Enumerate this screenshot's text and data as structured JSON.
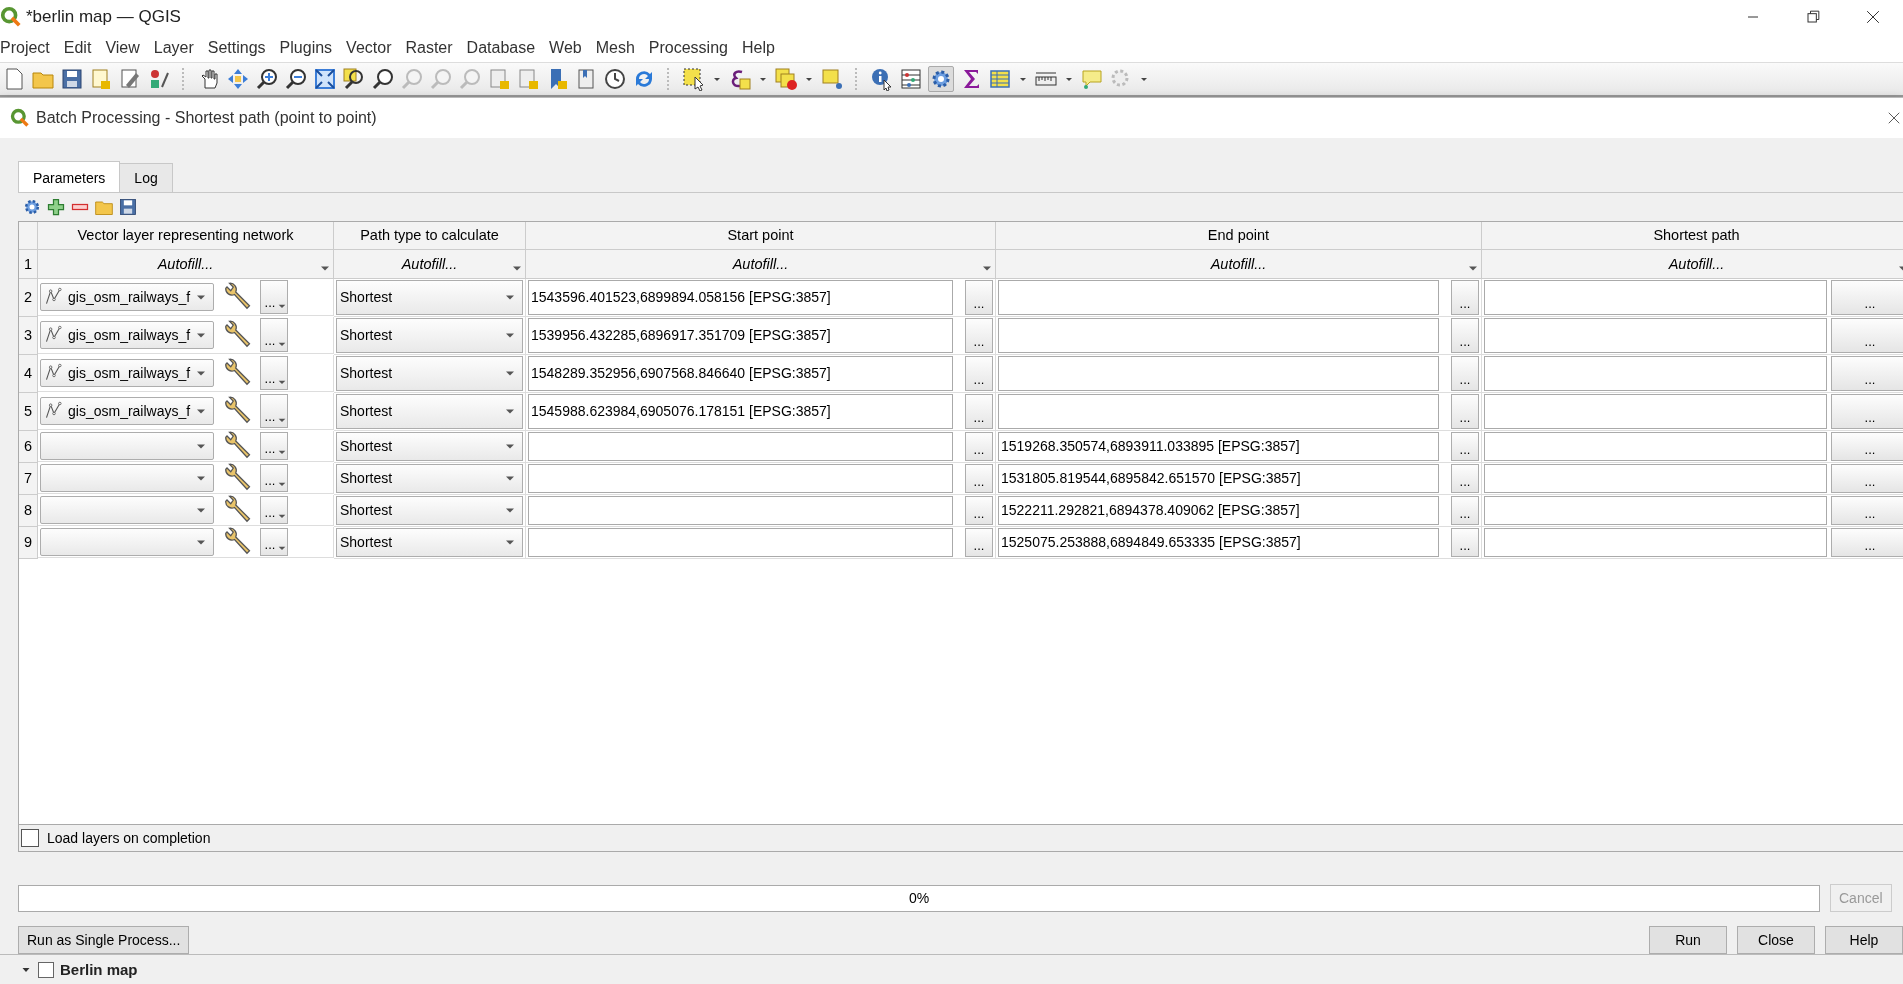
{
  "window": {
    "title": "*berlin map — QGIS"
  },
  "menu": [
    "Project",
    "Edit",
    "View",
    "Layer",
    "Settings",
    "Plugins",
    "Vector",
    "Raster",
    "Database",
    "Web",
    "Mesh",
    "Processing",
    "Help"
  ],
  "dialog": {
    "title": "Batch Processing - Shortest path (point to point)",
    "tabs": [
      {
        "label": "Parameters",
        "selected": true
      },
      {
        "label": "Log",
        "selected": false
      }
    ],
    "table": {
      "columns": [
        "Vector layer representing network",
        "Path type to calculate",
        "Start point",
        "End point",
        "Shortest path"
      ],
      "autofill_row": {
        "number": "1",
        "labels": [
          "Autofill...",
          "Autofill...",
          "Autofill...",
          "Autofill...",
          "Autofill..."
        ]
      },
      "rows": [
        {
          "number": "2",
          "layer": "gis_osm_railways_f",
          "layer_button": "...",
          "path_type": "Shortest",
          "start_point": "1543596.401523,6899894.058156 [EPSG:3857]",
          "start_button": "...",
          "end_button": "...",
          "output_button": "..."
        },
        {
          "number": "3",
          "layer": "gis_osm_railways_f",
          "layer_button": "...",
          "path_type": "Shortest",
          "start_point": "1539956.432285,6896917.351709 [EPSG:3857]",
          "start_button": "...",
          "end_button": "...",
          "output_button": "..."
        },
        {
          "number": "4",
          "layer": "gis_osm_railways_f",
          "layer_button": "...",
          "path_type": "Shortest",
          "start_point": "1548289.352956,6907568.846640 [EPSG:3857]",
          "start_button": "...",
          "end_button": "...",
          "output_button": "..."
        },
        {
          "number": "5",
          "layer": "gis_osm_railways_f",
          "layer_button": "...",
          "path_type": "Shortest",
          "start_point": "1545988.623984,6905076.178151 [EPSG:3857]",
          "start_button": "...",
          "end_button": "...",
          "output_button": "..."
        },
        {
          "number": "6",
          "layer_button": "...",
          "path_type": "Shortest",
          "start_button": "...",
          "end_point": "1519268.350574,6893911.033895 [EPSG:3857]",
          "end_button": "...",
          "output_button": "..."
        },
        {
          "number": "7",
          "layer_button": "...",
          "path_type": "Shortest",
          "start_button": "...",
          "end_point": "1531805.819544,6895842.651570 [EPSG:3857]",
          "end_button": "...",
          "output_button": "..."
        },
        {
          "number": "8",
          "layer_button": "...",
          "path_type": "Shortest",
          "start_button": "...",
          "end_point": "1522211.292821,6894378.409062 [EPSG:3857]",
          "end_button": "...",
          "output_button": "..."
        },
        {
          "number": "9",
          "layer_button": "...",
          "path_type": "Shortest",
          "start_button": "...",
          "end_point": "1525075.253888,6894849.653335 [EPSG:3857]",
          "end_button": "...",
          "output_button": "..."
        }
      ]
    },
    "load_layers": {
      "label": "Load layers on completion",
      "checked": false
    },
    "progress": {
      "level": 0,
      "text": "0%"
    },
    "cancel": {
      "label": "Cancel",
      "disabled": true
    },
    "single_process": {
      "label": "Run as Single Process..."
    },
    "buttons": [
      {
        "label": "Run",
        "disabled": false
      },
      {
        "label": "Close",
        "disabled": false
      },
      {
        "label": "Help",
        "disabled": false
      }
    ]
  },
  "background": {
    "layer_name": "Berlin map",
    "checked": false
  }
}
